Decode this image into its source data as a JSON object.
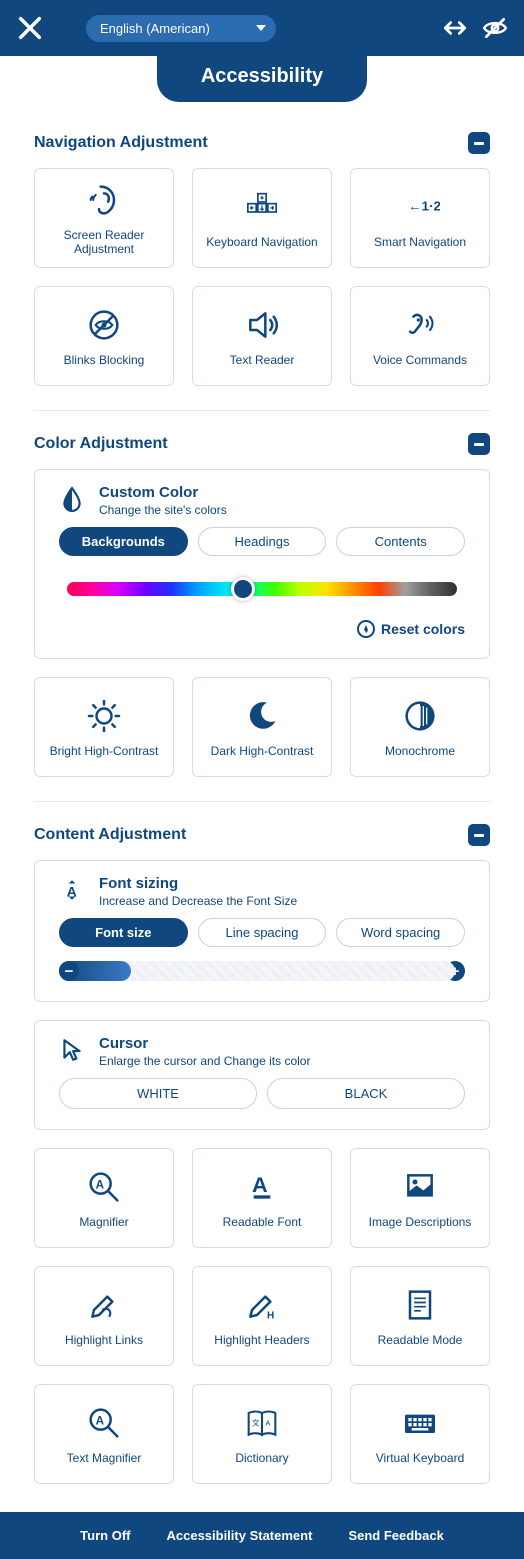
{
  "header": {
    "language": "English (American)",
    "title": "Accessibility"
  },
  "sections": {
    "navigation": {
      "title": "Navigation Adjustment",
      "tiles": [
        "Screen Reader Adjustment",
        "Keyboard Navigation",
        "Smart Navigation",
        "Blinks Blocking",
        "Text Reader",
        "Voice Commands"
      ]
    },
    "color": {
      "title": "Color Adjustment",
      "custom": {
        "title": "Custom Color",
        "subtitle": "Change the site's colors",
        "tabs": [
          "Backgrounds",
          "Headings",
          "Contents"
        ],
        "reset": "Reset colors"
      },
      "tiles": [
        "Bright High-Contrast",
        "Dark High-Contrast",
        "Monochrome"
      ]
    },
    "content": {
      "title": "Content Adjustment",
      "font": {
        "title": "Font sizing",
        "subtitle": "Increase and Decrease the Font Size",
        "tabs": [
          "Font size",
          "Line spacing",
          "Word spacing"
        ]
      },
      "cursor": {
        "title": "Cursor",
        "subtitle": "Enlarge the cursor and Change its color",
        "options": [
          "WHITE",
          "BLACK"
        ]
      },
      "tiles": [
        "Magnifier",
        "Readable Font",
        "Image Descriptions",
        "Highlight Links",
        "Highlight Headers",
        "Readable Mode",
        "Text Magnifier",
        "Dictionary",
        "Virtual Keyboard"
      ]
    }
  },
  "footer": {
    "turnOff": "Turn Off",
    "statement": "Accessibility Statement",
    "feedback": "Send Feedback"
  }
}
